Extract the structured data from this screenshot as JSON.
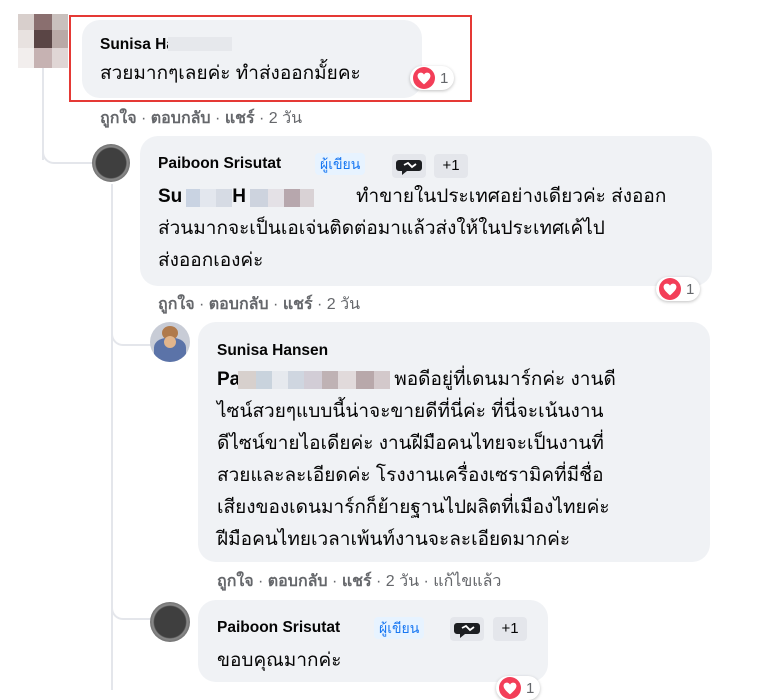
{
  "comment1": {
    "author": "Sunisa Hansen",
    "text": "สวยมากๆเลยค่ะ ทำส่งออกมั้ยคะ",
    "reaction_count": "1",
    "actions": {
      "like": "ถูกใจ",
      "reply": "ตอบกลับ",
      "share": "แชร์",
      "time": "2 วัน"
    }
  },
  "comment2": {
    "author": "Paiboon Srisutat",
    "badge": "ผู้เขียน",
    "plus": "+1",
    "mention": "Su",
    "mention_tail": "H",
    "lines": [
      "ทำขายในประเทศอย่างเดียวค่ะ ส่งออก",
      "ส่วนมากจะเป็นเอเจ่นติดต่อมาแล้วส่งให้ในประเทศเค้ไป",
      "ส่งออกเองค่ะ"
    ],
    "reaction_count": "1",
    "actions": {
      "like": "ถูกใจ",
      "reply": "ตอบกลับ",
      "share": "แชร์",
      "time": "2 วัน"
    }
  },
  "comment3": {
    "author": "Sunisa Hansen",
    "mention": "Pa",
    "lines": [
      "พอดีอยู่ที่เดนมาร์กค่ะ งานดี",
      "ไซน์สวยๆแบบนี้น่าจะขายดีที่นี่ค่ะ ที่นี่จะเน้นงาน",
      "ดีไซน์ขายไอเดียค่ะ งานฝีมือคนไทยจะเป็นงานที่",
      "สวยและละเอียดค่ะ โรงงานเครื่องเซรามิคที่มีชื่อ",
      "เสียงของเดนมาร์กก็ย้ายฐานไปผลิตที่เมืองไทยค่ะ",
      "ฝีมือคนไทยเวลาเพ้นท์งานจะละเอียดมากค่ะ"
    ],
    "actions": {
      "like": "ถูกใจ",
      "reply": "ตอบกลับ",
      "share": "แชร์",
      "time": "2 วัน",
      "edited": "แก้ไขแล้ว"
    }
  },
  "comment4": {
    "author": "Paiboon Srisutat",
    "badge": "ผู้เขียน",
    "plus": "+1",
    "text": "ขอบคุณมากค่ะ",
    "reaction_count": "1"
  },
  "colors": {
    "highlight_box": "#e53935",
    "heart": "#f33e58",
    "author_badge": "#1877f2"
  },
  "icons": [
    "heart-reaction-icon",
    "top-fan-icon"
  ]
}
